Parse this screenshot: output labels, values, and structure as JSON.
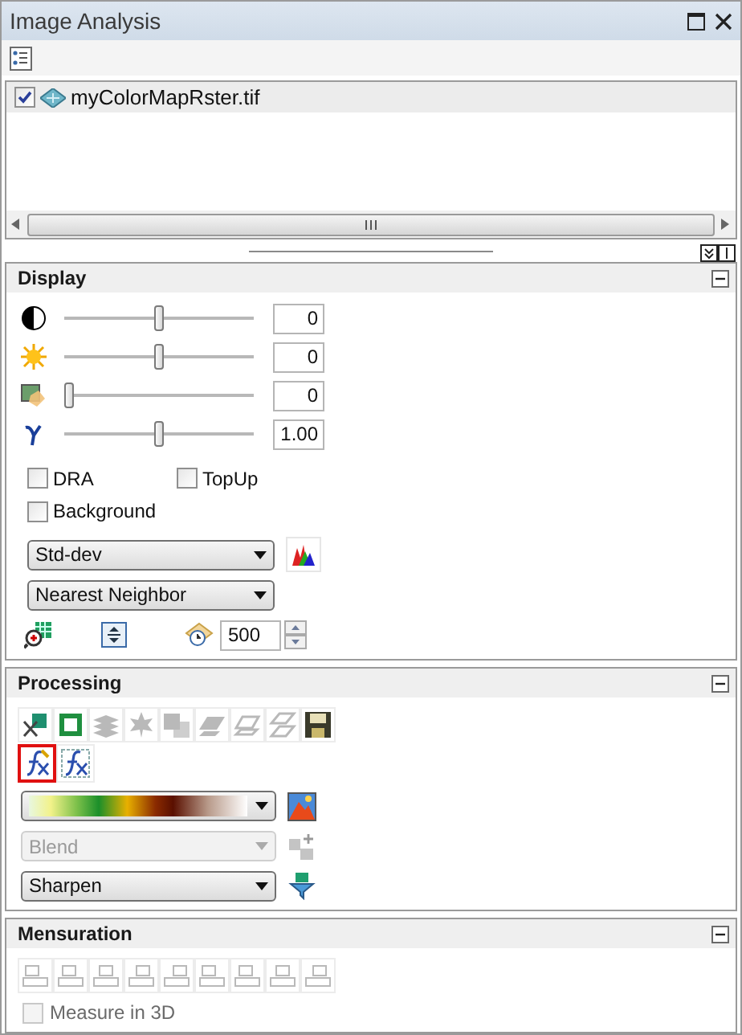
{
  "window": {
    "title": "Image Analysis"
  },
  "layers": [
    {
      "name": "myColorMapRster.tif",
      "checked": true,
      "selected": true
    }
  ],
  "display": {
    "title": "Display",
    "expanded": true,
    "sliders": [
      {
        "level": 0.5,
        "value": "0"
      },
      {
        "level": 0.5,
        "value": "0"
      },
      {
        "level": 0.0,
        "value": "0"
      },
      {
        "level": 0.5,
        "value": "1.00"
      }
    ],
    "checkboxes": [
      {
        "label": "DRA",
        "checked": false
      },
      {
        "label": "TopUp",
        "checked": false
      },
      {
        "label": "Background",
        "checked": false
      }
    ],
    "stretch": {
      "value": "Std-dev"
    },
    "resampling": {
      "value": "Nearest Neighbor"
    },
    "refresh": {
      "value": "500"
    }
  },
  "processing": {
    "title": "Processing",
    "expanded": true,
    "tools": [
      {
        "disabled": false
      },
      {
        "disabled": false
      },
      {
        "disabled": true
      },
      {
        "disabled": true
      },
      {
        "disabled": true
      },
      {
        "disabled": true
      },
      {
        "disabled": true
      },
      {
        "disabled": true
      },
      {
        "disabled": false
      }
    ],
    "functions": [
      {
        "selected": true
      },
      {
        "selected": false
      }
    ],
    "blend": {
      "value": "Blend",
      "disabled": true
    },
    "filter": {
      "value": "Sharpen",
      "disabled": false
    }
  },
  "mensuration": {
    "title": "Mensuration",
    "expanded": true,
    "tools": [
      {
        "disabled": true
      },
      {
        "disabled": true
      },
      {
        "disabled": true
      },
      {
        "disabled": true
      },
      {
        "disabled": true
      },
      {
        "disabled": true
      },
      {
        "disabled": true
      },
      {
        "disabled": true
      },
      {
        "disabled": true
      }
    ],
    "measure_3d": {
      "label": "Measure in 3D",
      "checked": false,
      "disabled": true
    }
  }
}
